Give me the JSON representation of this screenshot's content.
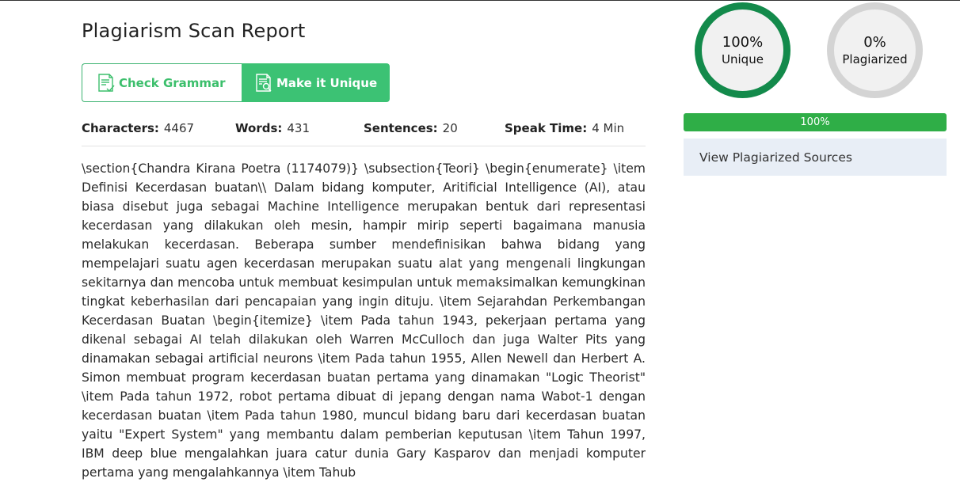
{
  "report": {
    "title": "Plagiarism Scan Report"
  },
  "actions": {
    "check_grammar": "Check Grammar",
    "make_unique": "Make it Unique"
  },
  "stats": {
    "characters_label": "Characters:",
    "characters_value": "4467",
    "words_label": "Words:",
    "words_value": "431",
    "sentences_label": "Sentences:",
    "sentences_value": "20",
    "speak_time_label": "Speak Time:",
    "speak_time_value": "4 Min"
  },
  "content": {
    "text": "\\section{Chandra Kirana Poetra (1174079)} \\subsection{Teori} \\begin{enumerate} \\item Definisi Kecerdasan buatan\\\\ Dalam bidang komputer, Aritificial Intelligence (AI), atau biasa disebut juga sebagai Machine Intelligence merupakan bentuk dari representasi kecerdasan yang dilakukan oleh mesin, hampir mirip seperti bagaimana manusia melakukan kecerdasan. Beberapa sumber mendefinisikan bahwa bidang yang mempelajari suatu agen kecerdasan merupakan suatu alat yang mengenali lingkungan sekitarnya dan mencoba untuk membuat kesimpulan untuk memaksimalkan kemungkinan tingkat keberhasilan dari pencapaian yang ingin dituju. \\item Sejarahdan Perkembangan Kecerdasan Buatan \\begin{itemize} \\item Pada tahun 1943, pekerjaan pertama yang dikenal sebagai AI telah dilakukan oleh Warren McCulloch dan juga Walter Pits yang dinamakan sebagai artificial neurons \\item Pada tahun 1955, Allen Newell dan Herbert A. Simon membuat program kecerdasan buatan pertama yang dinamakan \"Logic Theorist\" \\item Pada tahun 1972, robot pertama dibuat di jepang dengan nama Wabot-1 dengan kecerdasan buatan \\item Pada tahun 1980, muncul bidang baru dari kecerdasan buatan yaitu \"Expert System\" yang membantu dalam pemberian keputusan \\item Tahun 1997, IBM deep blue mengalahkan juara catur dunia Gary Kasparov dan menjadi komputer pertama yang mengalahkannya \\item Tahub"
  },
  "results": {
    "unique_percent": "100%",
    "unique_label": "Unique",
    "plagiarized_percent": "0%",
    "plagiarized_label": "Plagiarized",
    "progress_text": "100%",
    "progress_value": 100,
    "view_sources": "View Plagiarized Sources"
  },
  "colors": {
    "unique_ring": "#138a4b",
    "plagiarized_ring": "#d4d4d4",
    "progress": "#2fae47",
    "accent": "#3cc274"
  },
  "icons": {
    "check_grammar": "document-check-icon",
    "make_unique": "document-search-icon"
  }
}
